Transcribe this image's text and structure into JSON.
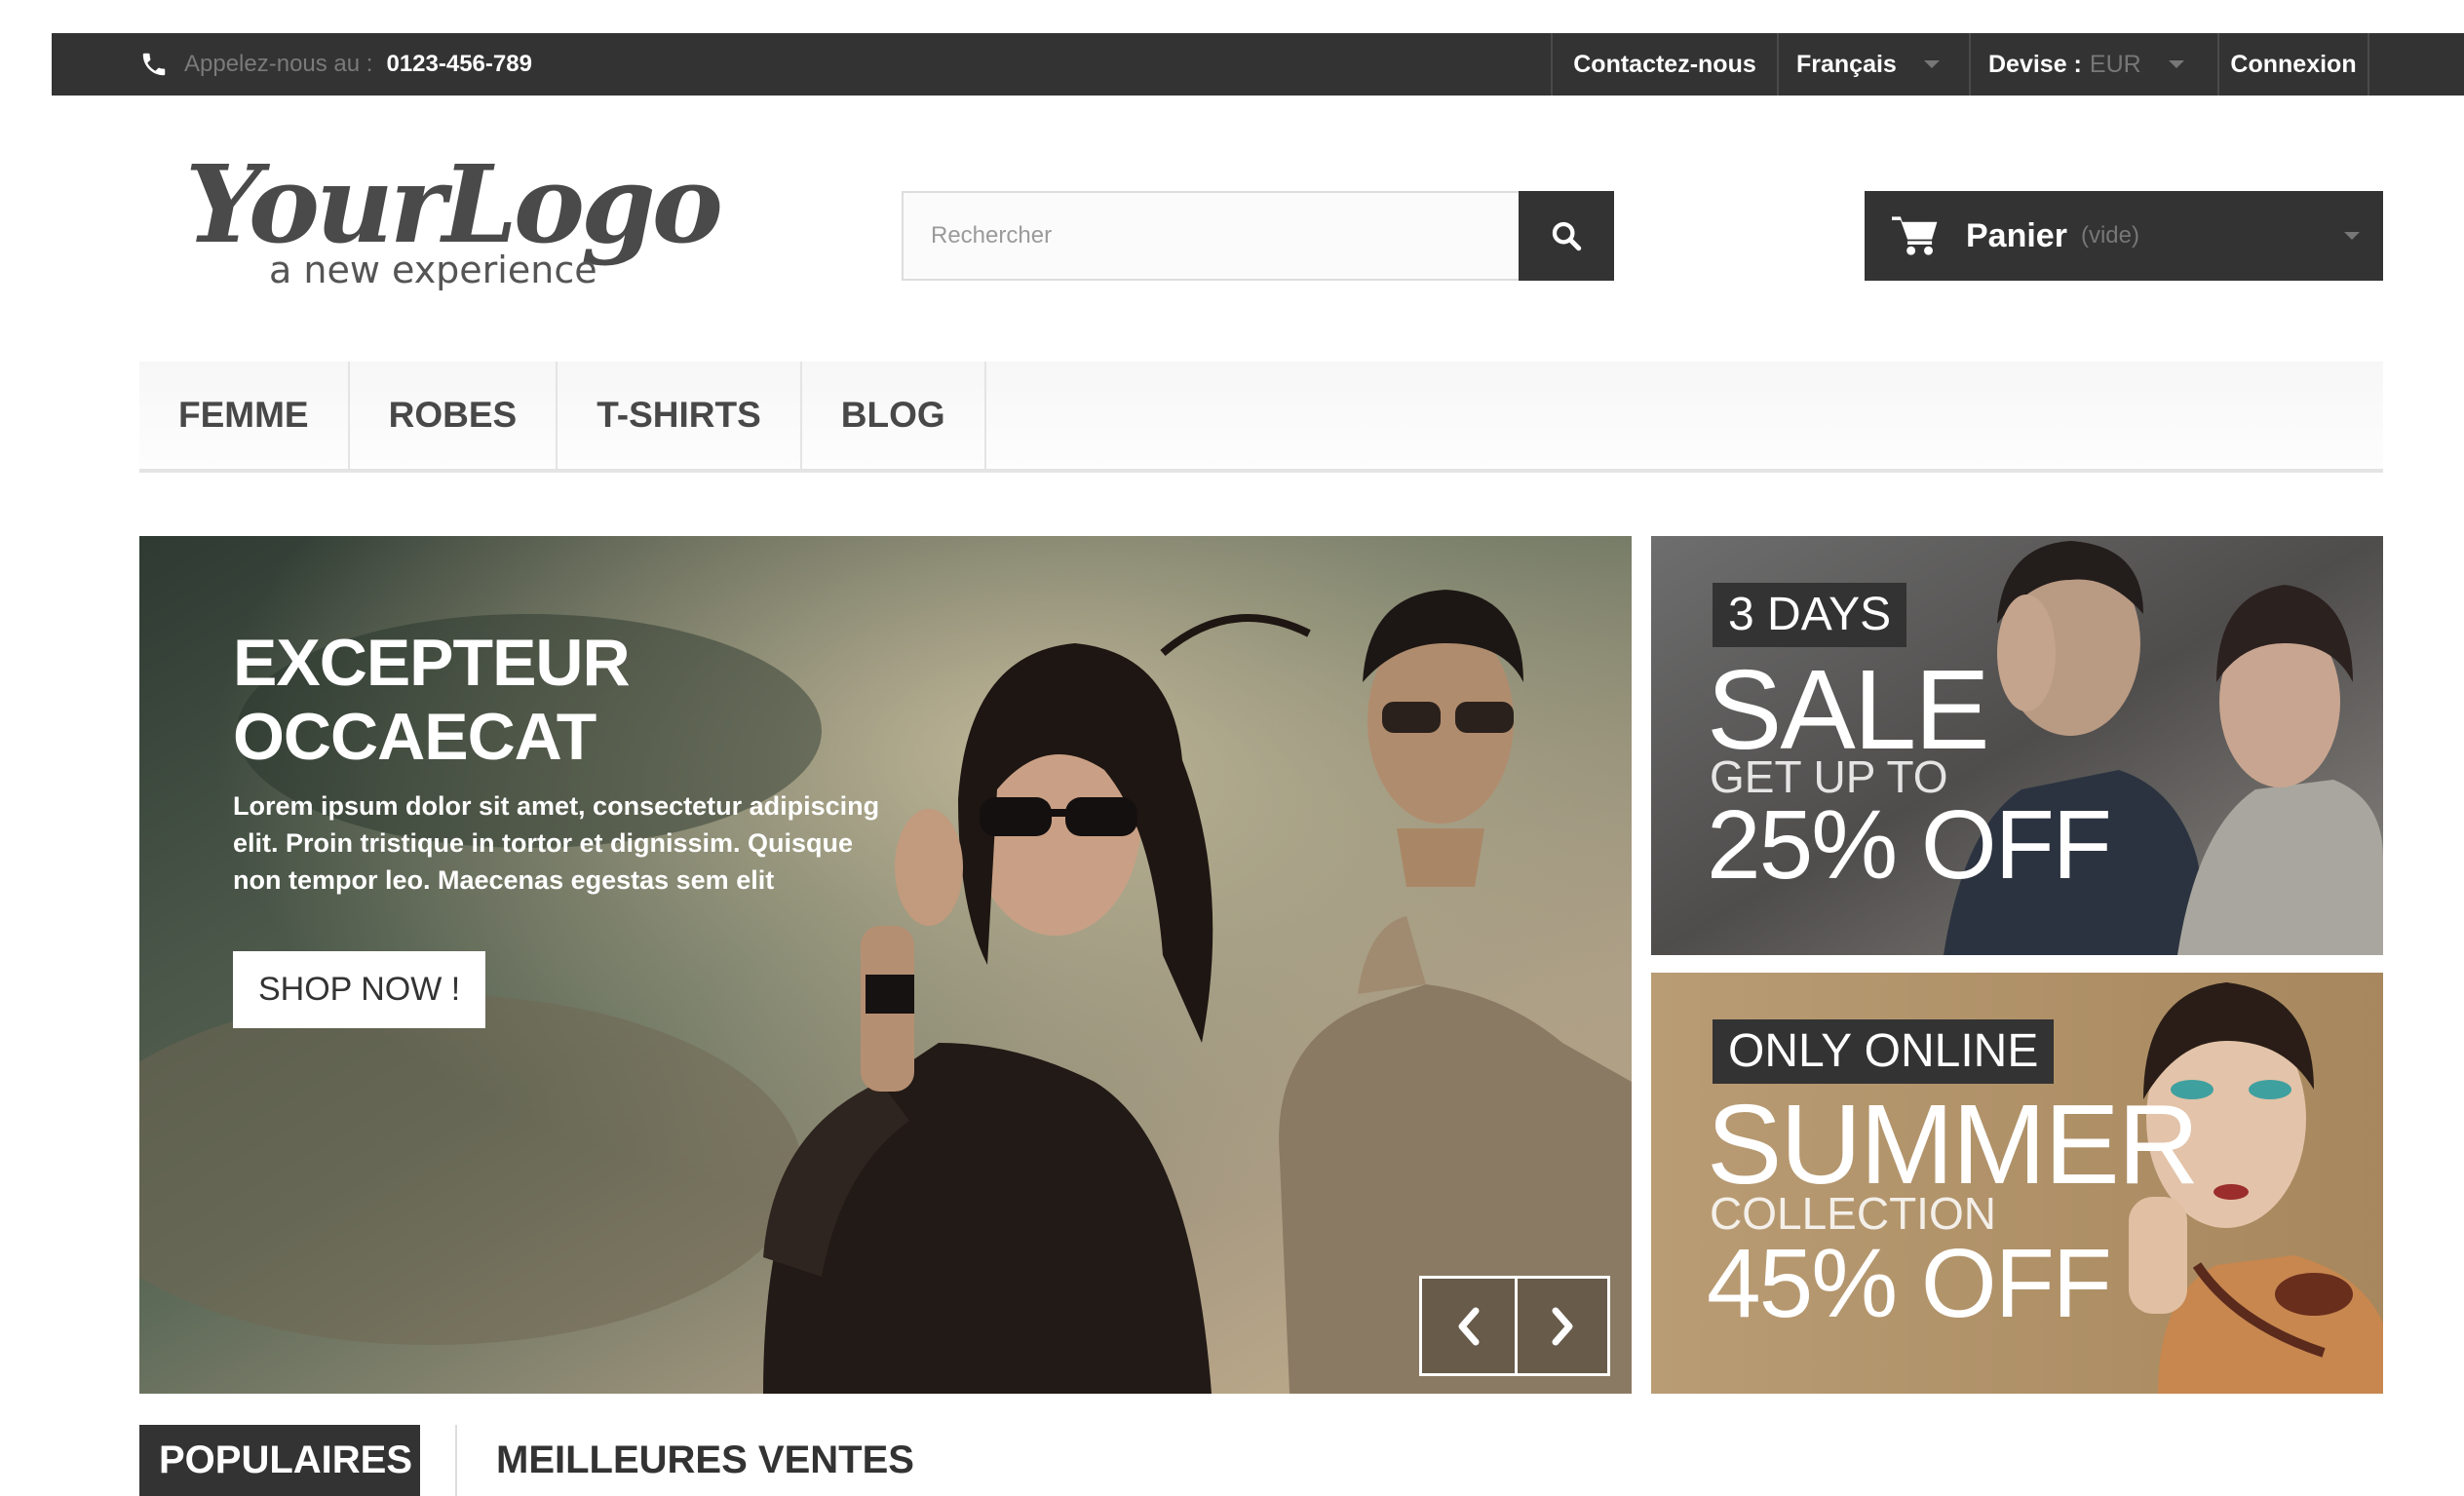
{
  "topbar": {
    "phone_label": "Appelez-nous au :",
    "phone_number": "0123-456-789",
    "contact": "Contactez-nous",
    "language": "Français",
    "currency_label": "Devise :",
    "currency_value": "EUR",
    "login": "Connexion"
  },
  "logo": {
    "text": "YourLogo",
    "tagline": "a new experience"
  },
  "search": {
    "placeholder": "Rechercher"
  },
  "cart": {
    "label": "Panier",
    "status": "(vide)"
  },
  "menu": {
    "items": [
      "FEMME",
      "ROBES",
      "T-SHIRTS",
      "BLOG"
    ]
  },
  "slider": {
    "title_line1": "EXCEPTEUR",
    "title_line2": "OCCAECAT",
    "description": "Lorem ipsum dolor sit amet, consectetur adipiscing elit. Proin tristique in tortor et dignissim. Quisque non tempor leo. Maecenas egestas sem elit",
    "button": "SHOP NOW !"
  },
  "banner1": {
    "badge": "3 DAYS",
    "big": "SALE",
    "small": "GET UP TO",
    "offer": "25% OFF"
  },
  "banner2": {
    "badge": "ONLY ONLINE",
    "big": "SUMMER",
    "small": "COLLECTION",
    "offer": "45% OFF"
  },
  "tabs": {
    "active": "POPULAIRES",
    "inactive": "MEILLEURES VENTES"
  },
  "colors": {
    "dark": "#333333",
    "muted": "#777777",
    "menu_bg": "#f7f7f7"
  },
  "icons": [
    "phone-icon",
    "search-icon",
    "cart-icon",
    "chevron-left-icon",
    "chevron-right-icon"
  ]
}
